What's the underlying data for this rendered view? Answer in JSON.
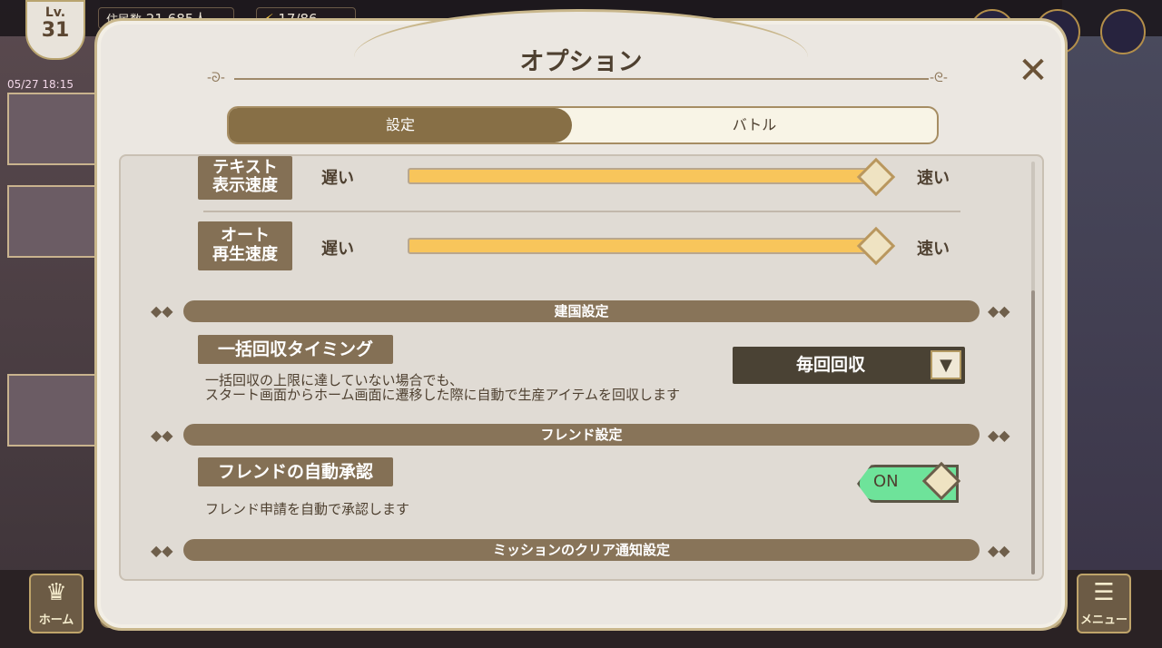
{
  "hud": {
    "level_prefix": "Lv.",
    "level": "31",
    "residents_label": "住民数",
    "residents_value": "21,685人",
    "stamina": "17/86",
    "date": "05/27 18:15"
  },
  "dialog": {
    "title": "オプション",
    "tabs": [
      {
        "label": "設定",
        "active": true
      },
      {
        "label": "バトル",
        "active": false
      }
    ]
  },
  "settings": {
    "text_speed": {
      "label_line1": "テキスト",
      "label_line2": "表示速度",
      "min": "遅い",
      "max": "速い",
      "level": 1.0
    },
    "auto_speed": {
      "label_line1": "オート",
      "label_line2": "再生速度",
      "min": "遅い",
      "max": "速い",
      "level": 1.0
    },
    "kingdom_section": "建国設定",
    "bulk_collect": {
      "label": "一括回収タイミング",
      "desc_line1": "一括回収の上限に達していない場合でも、",
      "desc_line2": "スタート画面からホーム画面に遷移した際に自動で生産アイテムを回収します",
      "selected": "毎回回収"
    },
    "friend_section": "フレンド設定",
    "friend_auto": {
      "label": "フレンドの自動承認",
      "desc": "フレンド申請を自動で承認します",
      "toggle": "ON"
    },
    "mission_section": "ミッションのクリア通知設定"
  },
  "bottom": {
    "home": "ホーム",
    "menu": "メニュー"
  },
  "colors": {
    "accent_brown": "#887459",
    "slider_fill": "#f8c55b",
    "toggle_on": "#6ee39a"
  }
}
